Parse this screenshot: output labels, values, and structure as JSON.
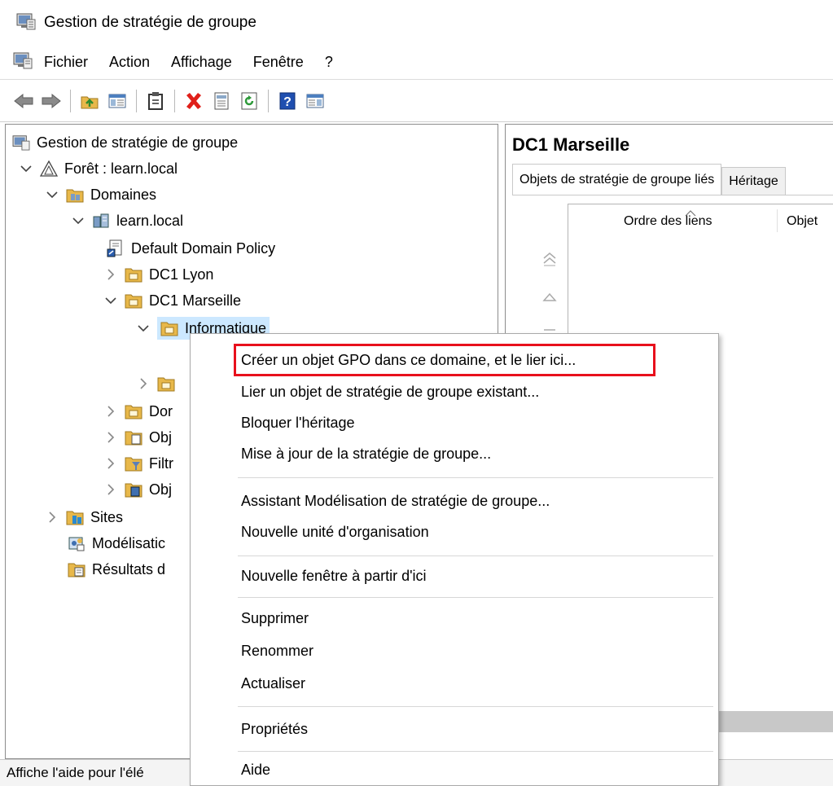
{
  "window": {
    "title": "Gestion de stratégie de groupe"
  },
  "menubar": {
    "items": [
      "Fichier",
      "Action",
      "Affichage",
      "Fenêtre",
      "?"
    ]
  },
  "tree": {
    "root": "Gestion de stratégie de groupe",
    "forest": "Forêt : learn.local",
    "domains": "Domaines",
    "domain": "learn.local",
    "default_policy": "Default Domain Policy",
    "ou_lyon": "DC1 Lyon",
    "ou_marseille": "DC1 Marseille",
    "ou_informatique": "Informatique",
    "partial_dor": "Dor",
    "partial_obj1": "Obj",
    "partial_filtr": "Filtr",
    "partial_obj2": "Obj",
    "sites": "Sites",
    "modelisation": "Modélisatic",
    "resultats": "Résultats d"
  },
  "right_pane": {
    "title": "DC1 Marseille",
    "tabs": [
      "Objets de stratégie de groupe liés",
      "Héritage"
    ],
    "columns": [
      "Ordre des liens",
      "Objet"
    ]
  },
  "status": {
    "text": "Affiche l'aide pour l'élé"
  },
  "context_menu": {
    "items": [
      "Créer un objet GPO dans ce domaine, et le lier ici...",
      "Lier un objet de stratégie de groupe existant...",
      "Bloquer l'héritage",
      "Mise à jour de la stratégie de groupe...",
      "Assistant Modélisation de stratégie de groupe...",
      "Nouvelle unité d'organisation",
      "Nouvelle fenêtre à partir d'ici",
      "Supprimer",
      "Renommer",
      "Actualiser",
      "Propriétés",
      "Aide"
    ]
  },
  "colors": {
    "highlight_border": "#e8101c",
    "selection": "#cce8ff",
    "folder": "#e8b84a"
  },
  "icons": {
    "window": "gpmc-console-icon",
    "back": "back-arrow-icon",
    "forward": "forward-arrow-icon",
    "up": "up-folder-icon",
    "show_tree": "show-tree-icon",
    "clipboard": "clipboard-icon",
    "delete": "delete-x-icon",
    "properties": "properties-icon",
    "refresh": "refresh-icon",
    "help": "help-icon",
    "action_pane": "action-pane-icon"
  }
}
